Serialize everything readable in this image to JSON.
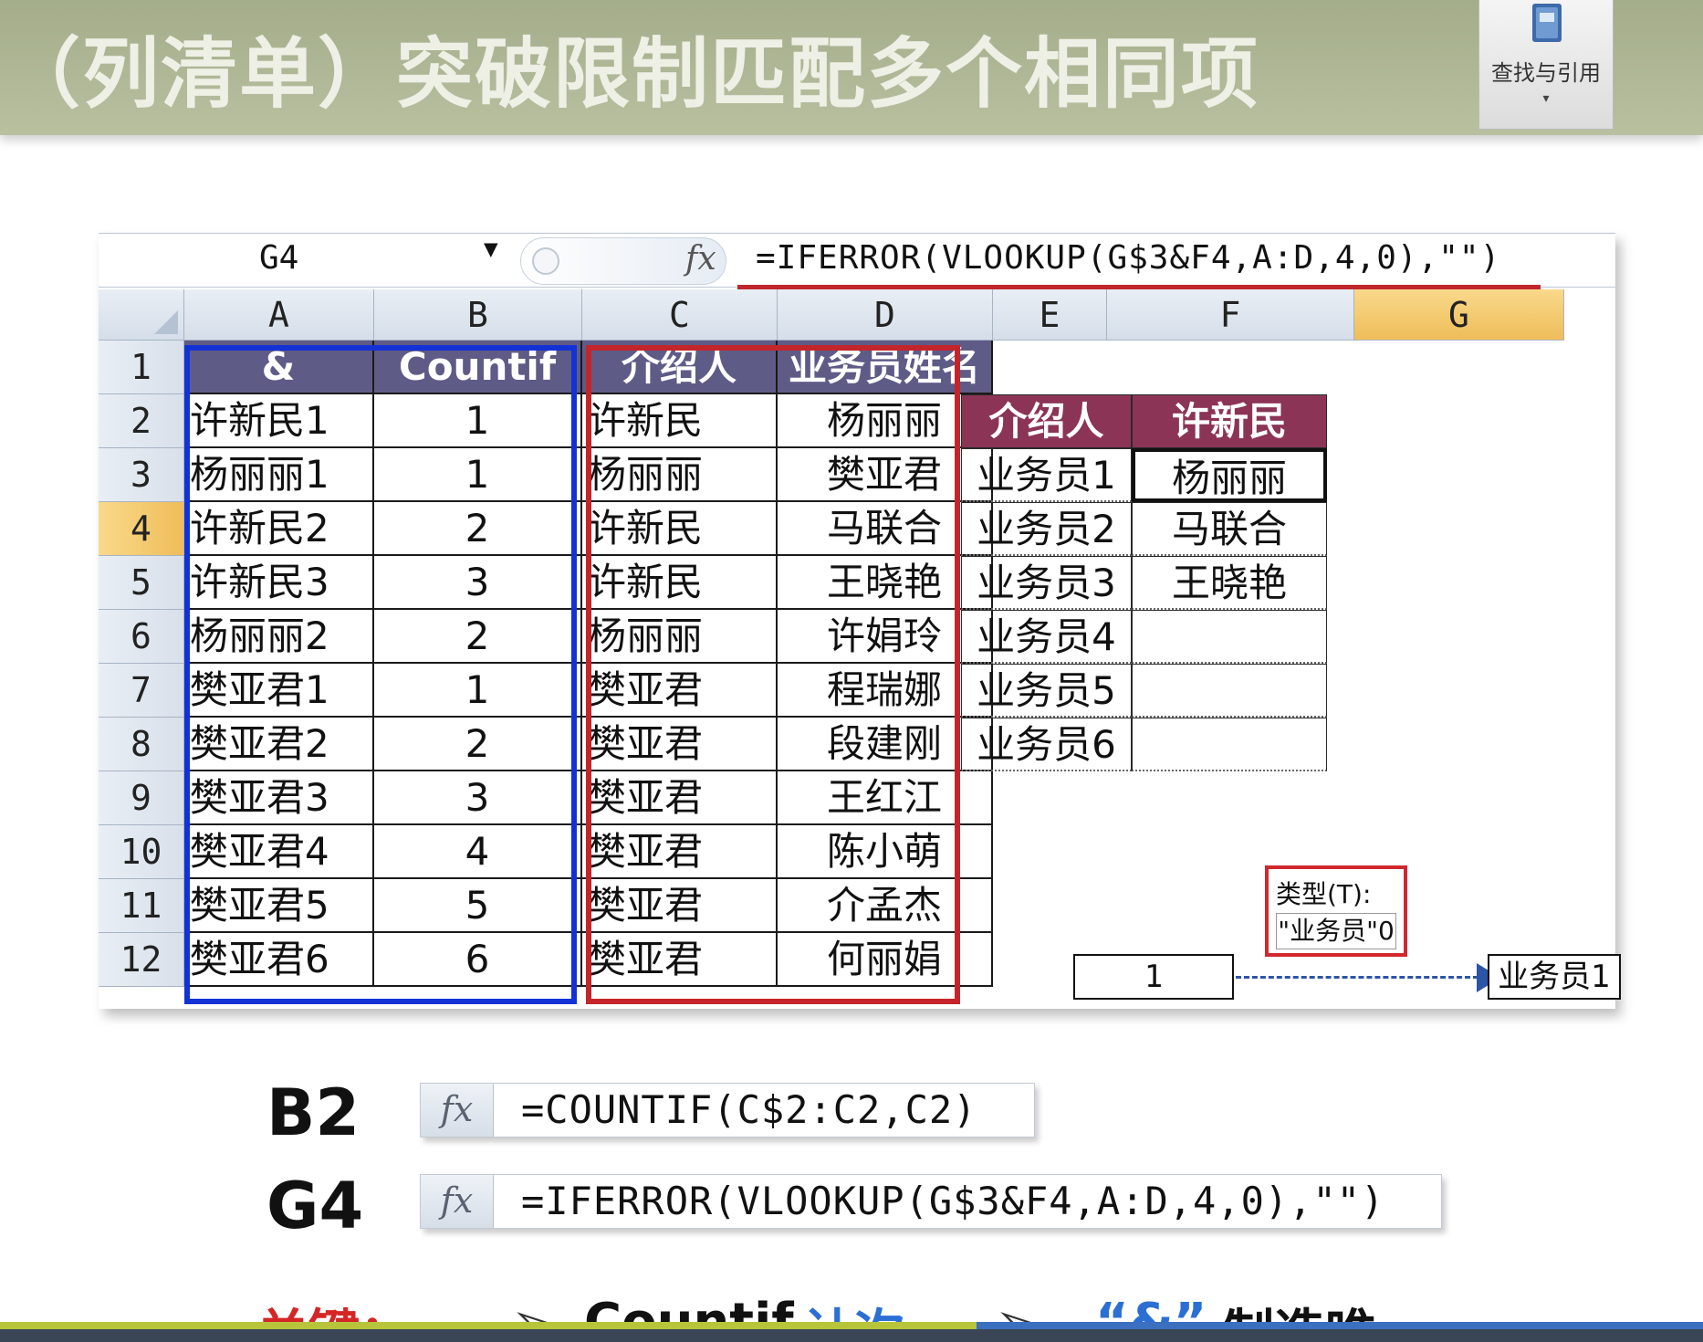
{
  "slide": {
    "title": "（列清单）突破限制匹配多个相同项",
    "ribbon_button": {
      "label": "查找与引用",
      "icon": "book-icon",
      "arrow": "▾"
    }
  },
  "excel": {
    "name_box": "G4",
    "fx": "fx",
    "formula": "=IFERROR(VLOOKUP(G$3&F4,A:D,4,0),\"\")",
    "columns": [
      "A",
      "B",
      "C",
      "D",
      "E",
      "F",
      "G"
    ],
    "active_column": "G",
    "rows": [
      "1",
      "2",
      "3",
      "4",
      "5",
      "6",
      "7",
      "8",
      "9",
      "10",
      "11",
      "12"
    ],
    "active_row": "4",
    "headers": {
      "a": "&",
      "b": "Countif",
      "c": "介绍人",
      "d": "业务员姓名"
    },
    "data": [
      {
        "a": "许新民1",
        "b": "1",
        "c": "许新民",
        "d": "杨丽丽"
      },
      {
        "a": "杨丽丽1",
        "b": "1",
        "c": "杨丽丽",
        "d": "樊亚君"
      },
      {
        "a": "许新民2",
        "b": "2",
        "c": "许新民",
        "d": "马联合"
      },
      {
        "a": "许新民3",
        "b": "3",
        "c": "许新民",
        "d": "王晓艳"
      },
      {
        "a": "杨丽丽2",
        "b": "2",
        "c": "杨丽丽",
        "d": "许娟玲"
      },
      {
        "a": "樊亚君1",
        "b": "1",
        "c": "樊亚君",
        "d": "程瑞娜"
      },
      {
        "a": "樊亚君2",
        "b": "2",
        "c": "樊亚君",
        "d": "段建刚"
      },
      {
        "a": "樊亚君3",
        "b": "3",
        "c": "樊亚君",
        "d": "王红江"
      },
      {
        "a": "樊亚君4",
        "b": "4",
        "c": "樊亚君",
        "d": "陈小萌"
      },
      {
        "a": "樊亚君5",
        "b": "5",
        "c": "樊亚君",
        "d": "介孟杰"
      },
      {
        "a": "樊亚君6",
        "b": "6",
        "c": "樊亚君",
        "d": "何丽娟"
      }
    ],
    "lookup": {
      "header_left": "介绍人",
      "header_right": "许新民",
      "rows": [
        {
          "label": "业务员1",
          "value": "杨丽丽"
        },
        {
          "label": "业务员2",
          "value": "马联合"
        },
        {
          "label": "业务员3",
          "value": "王晓艳"
        },
        {
          "label": "业务员4",
          "value": ""
        },
        {
          "label": "业务员5",
          "value": ""
        },
        {
          "label": "业务员6",
          "value": ""
        }
      ]
    },
    "custom_format": {
      "label": "类型(T):",
      "value": "\"业务员\"0"
    },
    "demo": {
      "input": "1",
      "output": "业务员1"
    }
  },
  "examples": [
    {
      "cell": "B2",
      "fx": "fx",
      "formula": "=COUNTIF(C$2:C2,C2)"
    },
    {
      "cell": "G4",
      "fx": "fx",
      "formula": "=IFERROR(VLOOKUP(G$3&F4,A:D,4,0),\"\")"
    }
  ],
  "key_line": {
    "label": "关键：",
    "item1_prefix": "➢",
    "item1_a": "Countif",
    "item1_b": "计次",
    "item2_prefix": "➢",
    "item2_a": "“&”",
    "item2_b": "制造唯一"
  },
  "colors": {
    "title_bar": "#b1b997",
    "table_header": "#5f5b87",
    "lookup_header": "#8c3456",
    "blue_box": "#1232d6",
    "red_box": "#c4252b",
    "active_header": "#efbd59"
  }
}
